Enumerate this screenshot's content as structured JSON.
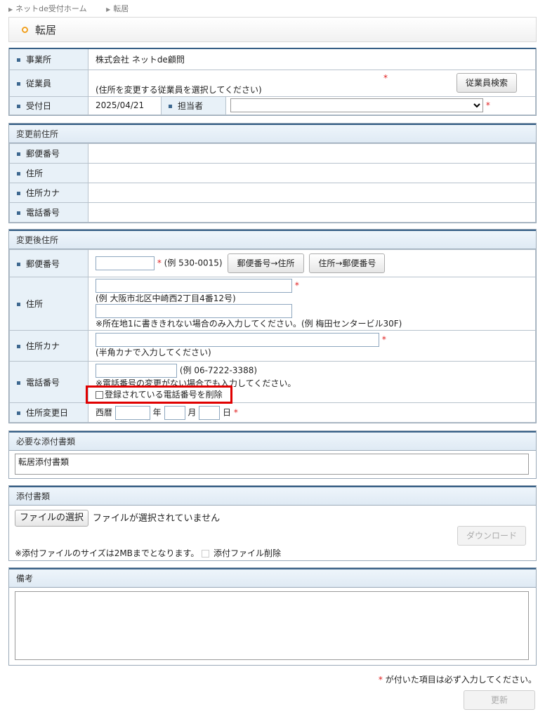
{
  "breadcrumb": {
    "items": [
      "ネットde受付ホーム",
      "転居"
    ]
  },
  "page_title": "転居",
  "section1": {
    "office_label": "事業所",
    "office_value": "株式会社 ネットde顧問",
    "employee_label": "従業員",
    "employee_note": "(住所を変更する従業員を選択してください)",
    "employee_search": "従業員検索",
    "received_label": "受付日",
    "received_value": "2025/04/21",
    "staff_label": "担当者",
    "required_mark": "*"
  },
  "before": {
    "title": "変更前住所",
    "postal_label": "郵便番号",
    "address_label": "住所",
    "kana_label": "住所カナ",
    "phone_label": "電話番号"
  },
  "after": {
    "title": "変更後住所",
    "postal_label": "郵便番号",
    "postal_example": "(例 530-0015)",
    "postal_to_address": "郵便番号→住所",
    "address_to_postal": "住所→郵便番号",
    "address_label": "住所",
    "address_example": "(例 大阪市北区中崎西2丁目4番12号)",
    "address_note": "※所在地1に書ききれない場合のみ入力してください。(例 梅田センタービル30F)",
    "kana_label": "住所カナ",
    "kana_note": "(半角カナで入力してください)",
    "phone_label": "電話番号",
    "phone_example": "(例 06-7222-3388)",
    "phone_note": "※電話番号の変更がない場合でも入力してください。",
    "phone_delete": "登録されている電話番号を削除",
    "date_label": "住所変更日",
    "era": "西暦",
    "year": "年",
    "month": "月",
    "day": "日"
  },
  "required_docs": {
    "title": "必要な添付書類",
    "content": "転居添付書類"
  },
  "attachments": {
    "title": "添付書類",
    "choose_file": "ファイルの選択",
    "no_file": "ファイルが選択されていません",
    "download": "ダウンロード",
    "size_note": "※添付ファイルのサイズは2MBまでとなります。",
    "delete_label": "添付ファイル削除"
  },
  "remarks": {
    "title": "備考",
    "content": ""
  },
  "footer": {
    "required_note": "が付いた項目は必ず入力してください。",
    "update": "更新"
  },
  "colors": {
    "required": "#e02020",
    "header_border": "#365f86",
    "label_bg": "#e8f1f8",
    "highlight": "#e00000"
  }
}
